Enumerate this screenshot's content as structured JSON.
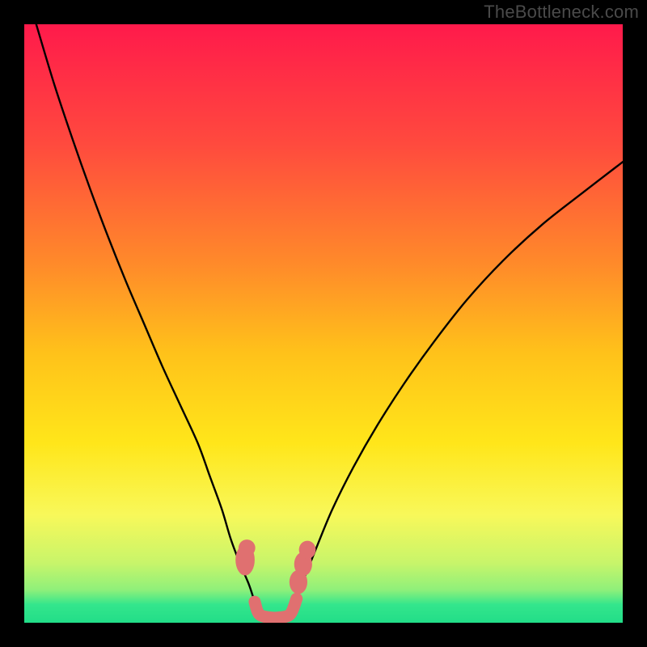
{
  "watermark": {
    "text": "TheBottleneck.com"
  },
  "colors": {
    "gradient_stops": [
      {
        "offset": 0.0,
        "color": "#ff1a4b"
      },
      {
        "offset": 0.2,
        "color": "#ff4a3e"
      },
      {
        "offset": 0.4,
        "color": "#ff8a2a"
      },
      {
        "offset": 0.55,
        "color": "#ffc21a"
      },
      {
        "offset": 0.7,
        "color": "#ffe61a"
      },
      {
        "offset": 0.82,
        "color": "#f8f85a"
      },
      {
        "offset": 0.9,
        "color": "#c8f56a"
      },
      {
        "offset": 0.945,
        "color": "#8ff07a"
      },
      {
        "offset": 0.97,
        "color": "#33e68c"
      },
      {
        "offset": 1.0,
        "color": "#22dd88"
      }
    ],
    "curve": "#000000",
    "blob": "#e07070",
    "blob_spot": "#e07070"
  },
  "chart_data": {
    "type": "line",
    "title": "",
    "xlabel": "",
    "ylabel": "",
    "xlim": [
      0,
      100
    ],
    "ylim": [
      0,
      100
    ],
    "series": [
      {
        "name": "left-curve",
        "x": [
          2,
          5,
          8,
          11,
          14,
          17,
          20,
          23,
          26,
          29,
          31,
          33,
          34.5,
          36,
          37.5,
          38.5,
          39.2
        ],
        "y": [
          100,
          90,
          81,
          72.5,
          64.5,
          57,
          50,
          43,
          36.5,
          30,
          24.5,
          19,
          14,
          10,
          6.5,
          3.5,
          1.5
        ]
      },
      {
        "name": "right-curve",
        "x": [
          44.5,
          45.5,
          47,
          49,
          51.5,
          55,
          59,
          63.5,
          68.5,
          74,
          80,
          86.5,
          93.5,
          100
        ],
        "y": [
          1.5,
          4,
          8,
          13,
          19,
          26,
          33,
          40,
          47,
          54,
          60.5,
          66.5,
          72,
          77
        ]
      }
    ],
    "valley_floor": {
      "x_start": 39.2,
      "x_end": 44.5,
      "y": 0.9
    },
    "blob_spots": [
      {
        "x": 36.9,
        "y": 10.5,
        "rx": 1.6,
        "ry": 2.6
      },
      {
        "x": 37.2,
        "y": 12.5,
        "rx": 1.4,
        "ry": 1.4
      },
      {
        "x": 45.8,
        "y": 6.8,
        "rx": 1.5,
        "ry": 2.0
      },
      {
        "x": 46.6,
        "y": 9.8,
        "rx": 1.5,
        "ry": 2.0
      },
      {
        "x": 47.3,
        "y": 12.2,
        "rx": 1.4,
        "ry": 1.5
      }
    ]
  }
}
